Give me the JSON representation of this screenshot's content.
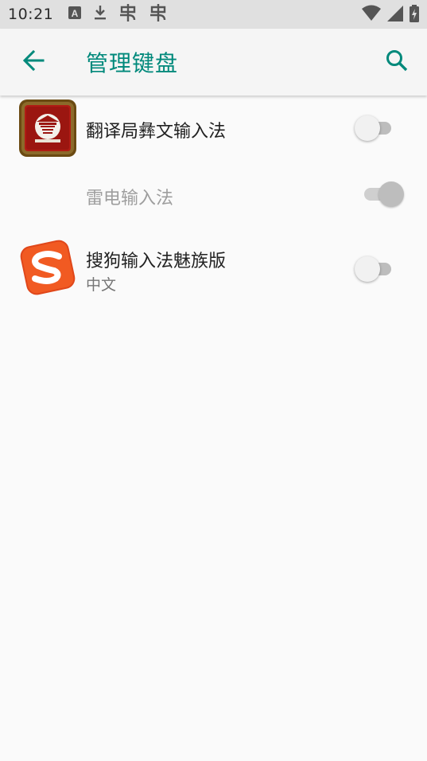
{
  "status_bar": {
    "time": "10:21",
    "icons_left": [
      "keyboard-a-icon",
      "download-icon",
      "bug-icon",
      "bug-icon"
    ],
    "icons_right": [
      "wifi-icon",
      "cellular-signal-icon",
      "battery-charging-icon"
    ]
  },
  "app_bar": {
    "title": "管理键盘",
    "back_icon": "arrow-back-icon",
    "search_icon": "search-icon",
    "accent_color": "#00897b"
  },
  "keyboards": [
    {
      "title": "翻译局彝文输入法",
      "subtitle": "",
      "enabled": false,
      "disabled": false
    },
    {
      "title": "雷电输入法",
      "subtitle": "",
      "enabled": true,
      "disabled": true
    },
    {
      "title": "搜狗输入法魅族版",
      "subtitle": "中文",
      "enabled": false,
      "disabled": false
    }
  ]
}
